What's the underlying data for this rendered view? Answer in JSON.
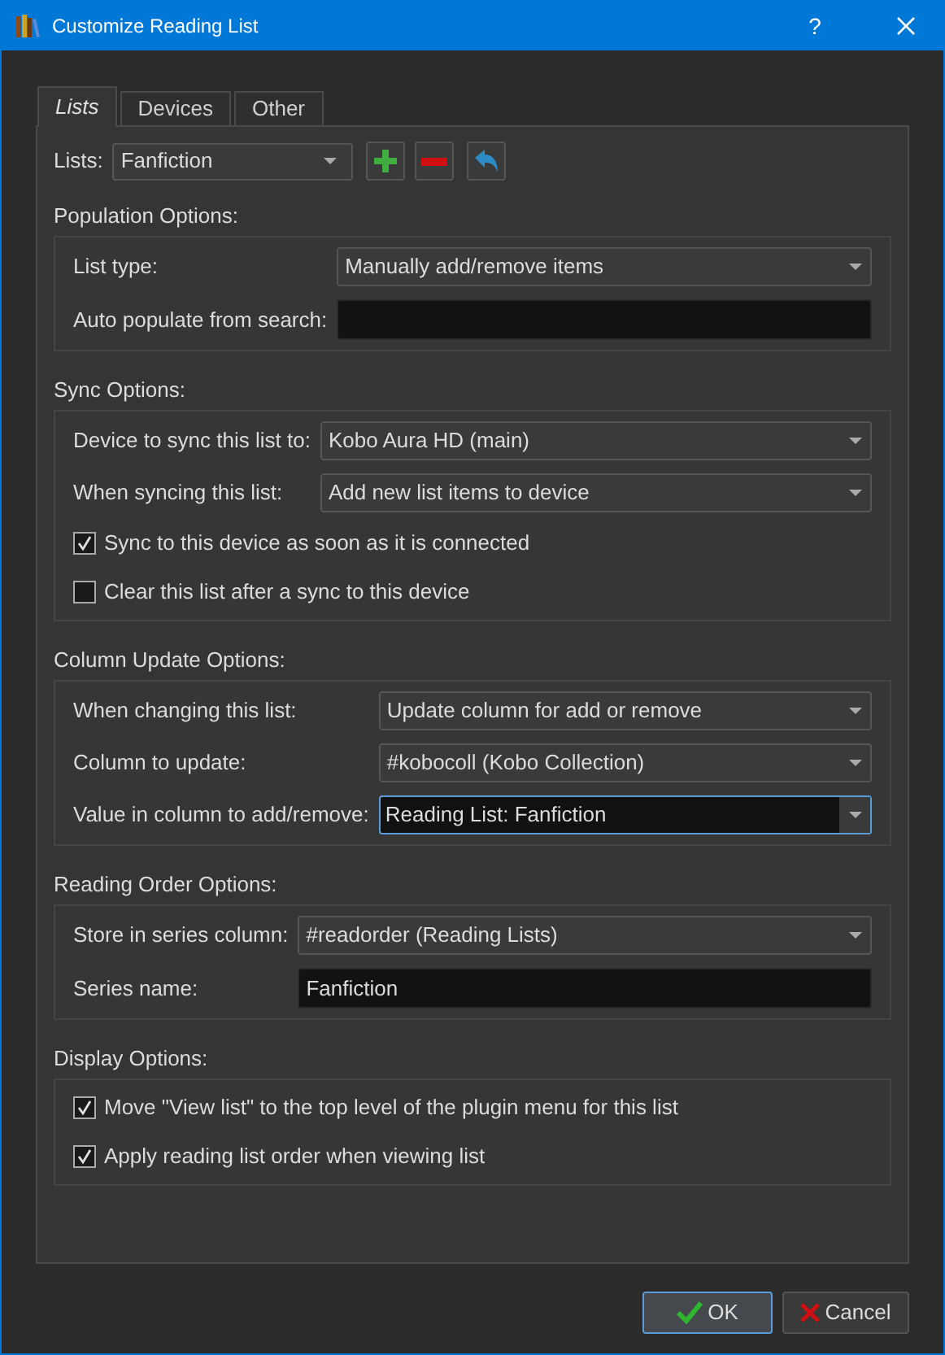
{
  "window": {
    "title": "Customize Reading List",
    "help": "?"
  },
  "tabs": [
    {
      "label": "Lists",
      "selected": true
    },
    {
      "label": "Devices",
      "selected": false
    },
    {
      "label": "Other",
      "selected": false
    }
  ],
  "lists_row": {
    "label": "Lists:",
    "value": "Fanfiction"
  },
  "groups": [
    {
      "title": "Population Options:",
      "rows": [
        {
          "kind": "combo",
          "label": "List type:",
          "value": "Manually add/remove items"
        },
        {
          "kind": "text",
          "label": "Auto populate from search:",
          "value": ""
        }
      ]
    },
    {
      "title": "Sync Options:",
      "rows": [
        {
          "kind": "combo",
          "label": "Device to sync this list to:",
          "value": "Kobo Aura HD (main)"
        },
        {
          "kind": "combo",
          "label": "When syncing this list:",
          "value": "Add new list items to device"
        },
        {
          "kind": "checkbox",
          "label": "Sync to this device as soon as it is connected",
          "checked": true
        },
        {
          "kind": "checkbox",
          "label": "Clear this list after a sync to this device",
          "checked": false
        }
      ]
    },
    {
      "title": "Column Update Options:",
      "rows": [
        {
          "kind": "combo",
          "label": "When changing this list:",
          "value": "Update column for add or remove"
        },
        {
          "kind": "combo",
          "label": "Column to update:",
          "value": "#kobocoll (Kobo Collection)"
        },
        {
          "kind": "editcombo",
          "label": "Value in column to add/remove:",
          "value": "Reading List: Fanfiction"
        }
      ]
    },
    {
      "title": "Reading Order Options:",
      "rows": [
        {
          "kind": "combo",
          "label": "Store in series column:",
          "value": "#readorder (Reading Lists)"
        },
        {
          "kind": "text",
          "label": "Series name:",
          "value": "Fanfiction"
        }
      ]
    },
    {
      "title": "Display Options:",
      "rows": [
        {
          "kind": "checkbox",
          "label": "Move \"View list\" to the top level of the plugin menu for this list",
          "checked": true
        },
        {
          "kind": "checkbox",
          "label": "Apply reading list order when viewing list",
          "checked": true
        }
      ]
    }
  ],
  "buttons": [
    {
      "kind": "ok",
      "label": "OK",
      "default": true
    },
    {
      "kind": "cancel",
      "label": "Cancel",
      "default": false
    }
  ]
}
